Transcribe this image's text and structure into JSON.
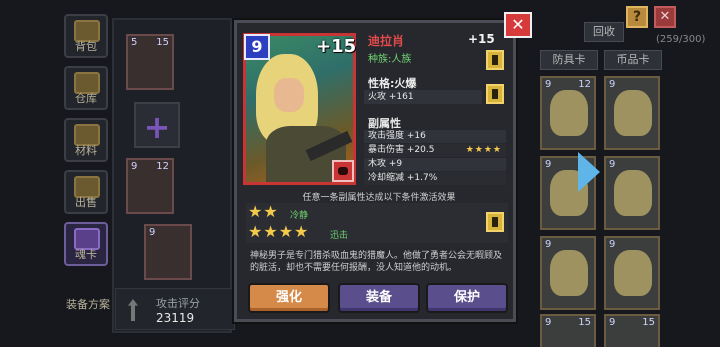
{
  "background": {
    "left_tabs": [
      {
        "label": "背包",
        "icon": "backpack-icon"
      },
      {
        "label": "仓库",
        "icon": "warehouse-icon"
      },
      {
        "label": "材料",
        "icon": "materials-icon"
      },
      {
        "label": "出售",
        "icon": "sell-icon"
      },
      {
        "label": "魂卡",
        "icon": "soul-card-icon"
      }
    ],
    "equipment_plan_label": "装备方案",
    "attack_score": {
      "label": "攻击评分",
      "value": "23119"
    },
    "mini_cards": [
      {
        "left": "5",
        "right": "15"
      },
      {
        "left": "9",
        "right": "12"
      },
      {
        "left": "9",
        "right": ""
      }
    ],
    "right_panel": {
      "recycle_label": "回收",
      "count_label": "(259/300)",
      "filter_defense_label": "防具卡",
      "filter_currency_label": "币品卡",
      "cards": [
        {
          "left": "9",
          "right": "12"
        },
        {
          "left": "9",
          "right": ""
        },
        {
          "left": "9",
          "right": ""
        },
        {
          "left": "9",
          "right": ""
        },
        {
          "left": "9",
          "right": ""
        },
        {
          "left": "9",
          "right": ""
        },
        {
          "left": "9",
          "right": "15"
        },
        {
          "left": "9",
          "right": "15"
        }
      ]
    }
  },
  "card": {
    "level": "9",
    "enhance": "+15",
    "name": "迪拉肖",
    "race": "种族:人族",
    "trait_title": "性格:火爆",
    "trait_value": "火攻 +161",
    "substats_title": "副属性",
    "substats": [
      {
        "text": "攻击强度 +16",
        "stars": ""
      },
      {
        "text": "暴击伤害 +20.5",
        "stars": "★★★★"
      },
      {
        "text": "木攻 +9",
        "stars": ""
      },
      {
        "text": "冷却缩减 +1.7%",
        "stars": ""
      }
    ],
    "set_note": "任意一条副属性达成以下条件激活效果",
    "set_bonuses": [
      {
        "stars": "★★",
        "name": "冷静"
      },
      {
        "stars": "★★★★",
        "name": "迅击"
      }
    ],
    "description": "神秘男子是专门猎杀吸血鬼的猎魔人。他做了勇者公会无暇顾及的脏活，却也不需要任何报酬，没人知道他的动机。"
  },
  "actions": {
    "enhance": "强化",
    "equip": "装备",
    "protect": "保护"
  },
  "colors": {
    "primary_button": "#d58a4a",
    "secondary_button": "#5a4f8c",
    "name_color": "#e04a4a",
    "race_color": "#6fd26f",
    "star_color": "#f2c94c"
  }
}
